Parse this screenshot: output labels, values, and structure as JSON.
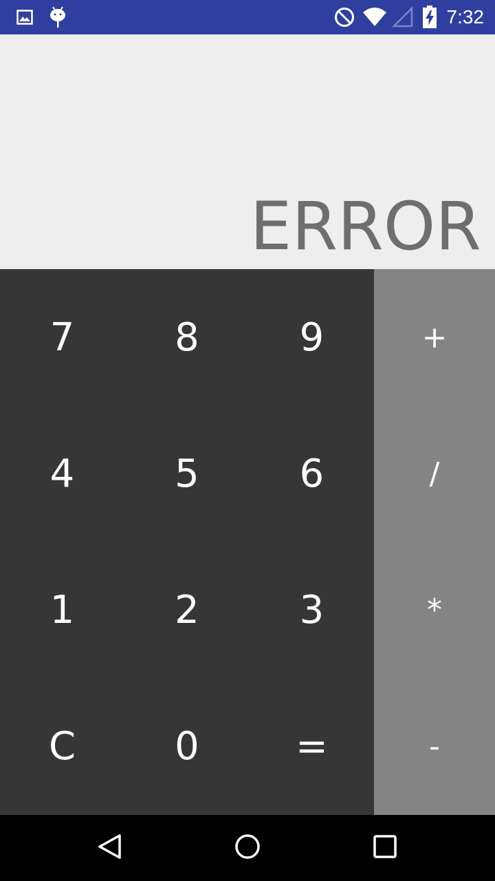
{
  "status_bar": {
    "time": "7:32",
    "icons": [
      "gallery-icon",
      "android-debug-icon",
      "do-not-disturb-icon",
      "wifi-icon",
      "cell-signal-icon",
      "battery-charging-icon"
    ],
    "background_color": "#303f9f"
  },
  "display": {
    "text": "ERROR",
    "text_color": "#6e6e6e",
    "background_color": "#eeeeee"
  },
  "keypad": {
    "background_color": "#363636",
    "keys": [
      {
        "label": "7",
        "name": "key-7"
      },
      {
        "label": "8",
        "name": "key-8"
      },
      {
        "label": "9",
        "name": "key-9"
      },
      {
        "label": "4",
        "name": "key-4"
      },
      {
        "label": "5",
        "name": "key-5"
      },
      {
        "label": "6",
        "name": "key-6"
      },
      {
        "label": "1",
        "name": "key-1"
      },
      {
        "label": "2",
        "name": "key-2"
      },
      {
        "label": "3",
        "name": "key-3"
      },
      {
        "label": "C",
        "name": "key-clear"
      },
      {
        "label": "0",
        "name": "key-0"
      },
      {
        "label": "=",
        "name": "key-equals"
      }
    ]
  },
  "operators": {
    "background_color": "#848484",
    "keys": [
      {
        "label": "+",
        "name": "key-plus"
      },
      {
        "label": "/",
        "name": "key-divide"
      },
      {
        "label": "*",
        "name": "key-multiply"
      },
      {
        "label": "-",
        "name": "key-minus"
      }
    ]
  },
  "nav_bar": {
    "icons": [
      "back-icon",
      "home-icon",
      "recents-icon"
    ]
  }
}
